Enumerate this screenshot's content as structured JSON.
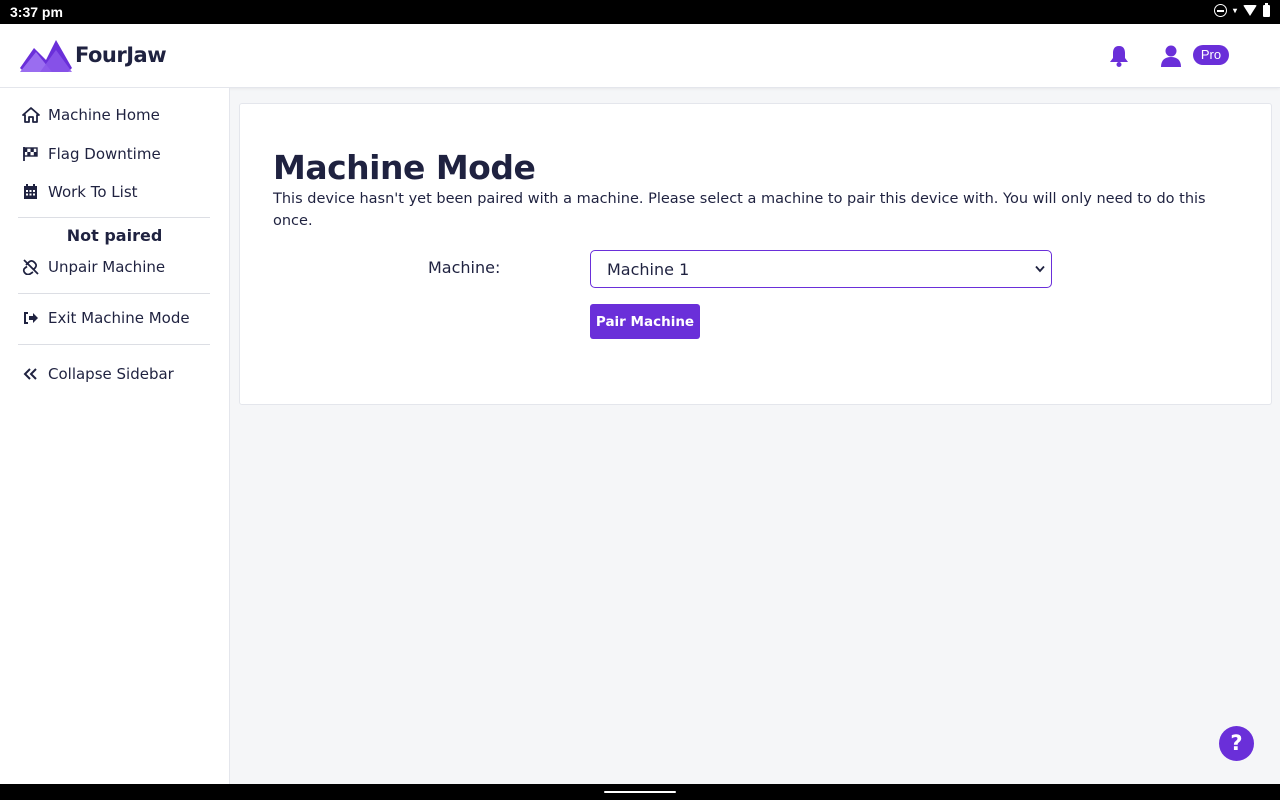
{
  "statusbar": {
    "time": "3:37 pm"
  },
  "header": {
    "brand": "FourJaw",
    "icons": [
      "bell-icon",
      "user-icon"
    ],
    "badge": "Pro",
    "accent": "#6a2fd9"
  },
  "sidebar": {
    "items": [
      {
        "label": "Machine Home",
        "icon": "home-icon"
      },
      {
        "label": "Flag Downtime",
        "icon": "checkered-flag-icon"
      },
      {
        "label": "Work To List",
        "icon": "calendar-icon"
      }
    ],
    "status": "Not paired",
    "unpair": {
      "label": "Unpair Machine",
      "icon": "unlink-icon"
    },
    "exit": {
      "label": "Exit Machine Mode",
      "icon": "sign-out-icon"
    },
    "collapse": {
      "label": "Collapse Sidebar",
      "icon": "double-chevron-left-icon"
    }
  },
  "main": {
    "title": "Machine Mode",
    "description": "This device hasn't yet been paired with a machine. Please select a machine to pair this device with. You will only need to do this once.",
    "machine_label": "Machine:",
    "machine_selected": "Machine 1",
    "pair_button": "Pair Machine"
  },
  "help": {
    "label": "?"
  }
}
